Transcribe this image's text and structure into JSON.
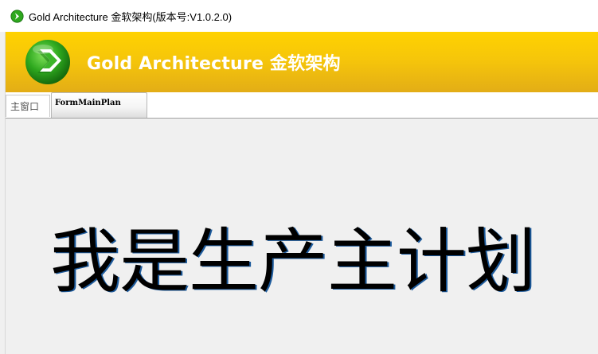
{
  "window": {
    "title": "Gold Architecture 金软架构(版本号:V1.0.2.0)"
  },
  "banner": {
    "title": "Gold Architecture 金软架构"
  },
  "tabs": [
    {
      "label": "主窗口",
      "active": false
    },
    {
      "label": "FormMainPlan",
      "active": true
    }
  ],
  "main": {
    "message": "我是生产主计划"
  },
  "colors": {
    "banner_top": "#ffd200",
    "banner_bottom": "#e3ad16",
    "logo_green": "#2ea81e",
    "content_bg": "#f0f0f0"
  },
  "icons": {
    "app": "green-arrow-circle-icon",
    "logo": "green-arrow-circle-logo"
  }
}
